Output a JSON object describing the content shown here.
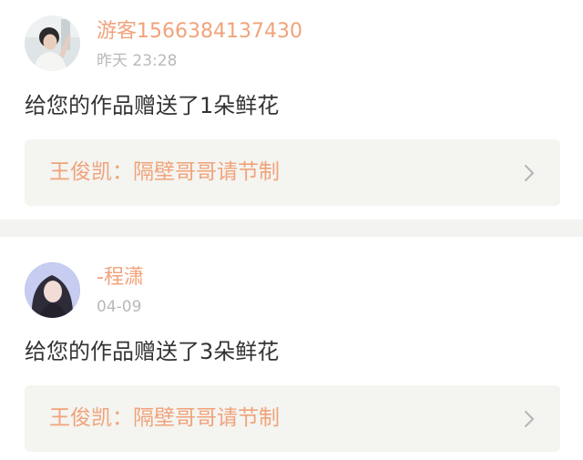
{
  "theme": {
    "accent": "#f0a37b",
    "muted": "#b9b9b9",
    "card_bg": "#f4f4f0"
  },
  "notifications": [
    {
      "avatar_icon": "boy-portrait-avatar",
      "username": "游客1566384137430",
      "time": "昨天 23:28",
      "message": "给您的作品赠送了1朵鲜花",
      "work_title": "王俊凯：隔壁哥哥请节制",
      "chevron_icon": "chevron-right-icon"
    },
    {
      "avatar_icon": "girl-portrait-avatar",
      "username": "-程潇",
      "time": "04-09",
      "message": "给您的作品赠送了3朵鲜花",
      "work_title": "王俊凯：隔壁哥哥请节制",
      "chevron_icon": "chevron-right-icon"
    }
  ]
}
